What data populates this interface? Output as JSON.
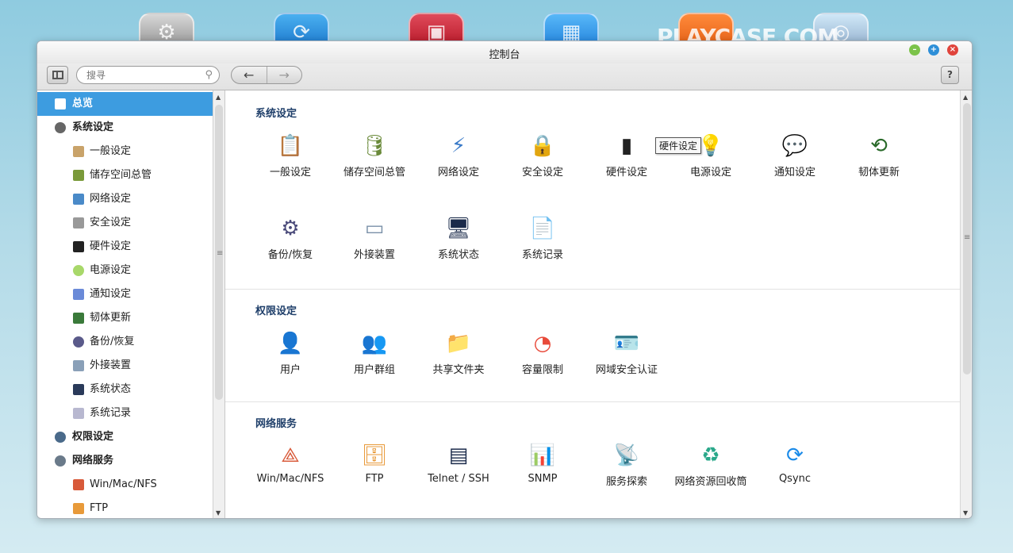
{
  "watermark": "PLAYCASE.COM",
  "window": {
    "title": "控制台"
  },
  "toolbar": {
    "search_placeholder": "搜寻",
    "back": "←",
    "forward": "→",
    "help": "?"
  },
  "tooltip": "硬件设定",
  "sidebar": {
    "items": [
      {
        "label": "总览",
        "level": "top",
        "active": true
      },
      {
        "label": "系统设定",
        "level": "top"
      },
      {
        "label": "一般设定",
        "level": "sub"
      },
      {
        "label": "储存空间总管",
        "level": "sub"
      },
      {
        "label": "网络设定",
        "level": "sub"
      },
      {
        "label": "安全设定",
        "level": "sub"
      },
      {
        "label": "硬件设定",
        "level": "sub"
      },
      {
        "label": "电源设定",
        "level": "sub"
      },
      {
        "label": "通知设定",
        "level": "sub"
      },
      {
        "label": "韧体更新",
        "level": "sub"
      },
      {
        "label": "备份/恢复",
        "level": "sub"
      },
      {
        "label": "外接装置",
        "level": "sub"
      },
      {
        "label": "系统状态",
        "level": "sub"
      },
      {
        "label": "系统记录",
        "level": "sub"
      },
      {
        "label": "权限设定",
        "level": "top"
      },
      {
        "label": "网络服务",
        "level": "top"
      },
      {
        "label": "Win/Mac/NFS",
        "level": "sub"
      },
      {
        "label": "FTP",
        "level": "sub"
      }
    ]
  },
  "sections": [
    {
      "title": "系统设定",
      "tiles": [
        "一般设定",
        "储存空间总管",
        "网络设定",
        "安全设定",
        "硬件设定",
        "电源设定",
        "通知设定",
        "韧体更新",
        "备份/恢复",
        "外接装置",
        "系统状态",
        "系统记录"
      ]
    },
    {
      "title": "权限设定",
      "tiles": [
        "用户",
        "用户群组",
        "共享文件夹",
        "容量限制",
        "网域安全认证"
      ]
    },
    {
      "title": "网络服务",
      "tiles": [
        "Win/Mac/NFS",
        "FTP",
        "Telnet / SSH",
        "SNMP",
        "服务探索",
        "网络资源回收筒",
        "Qsync"
      ]
    }
  ]
}
